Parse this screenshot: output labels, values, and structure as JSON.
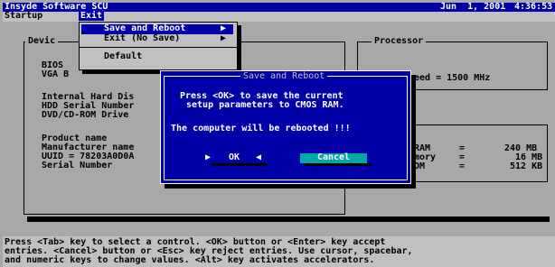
{
  "window": {
    "title": "Insyde Software SCU",
    "date": "Jun  1, 2001",
    "time": "4:36:53"
  },
  "menubar": {
    "items": [
      "Startup",
      "Exit"
    ]
  },
  "exit_menu": {
    "items": [
      {
        "label": "Save and Reboot",
        "arrow": "▶"
      },
      {
        "label": "Exit (No Save)",
        "arrow": "▶"
      },
      {
        "label": "Default",
        "arrow": ""
      }
    ]
  },
  "device_panel": {
    "title": "Devic",
    "lines": [
      "BIOS",
      "VGA B",
      "",
      "Internal Hard Dis",
      "HDD Serial Number",
      "DVD/CD-ROM Drive",
      "",
      "Product name",
      "Manufacturer name",
      "UUID = 78203A0D0A",
      "Serial Number"
    ]
  },
  "processor_panel": {
    "title": "Processor",
    "speed_text": "eed = 1500 MHz"
  },
  "memory_panel": {
    "rows": [
      {
        "label": "RAM",
        "eq": "=",
        "value": "240 MB"
      },
      {
        "label": "mory",
        "eq": "=",
        "value": "16 MB"
      },
      {
        "label": "OM",
        "eq": "=",
        "value": "512 KB"
      }
    ]
  },
  "dialog": {
    "title": "Save and Reboot",
    "message_line1": "Press <OK> to save the current",
    "message_line2": "setup parameters to CMOS RAM.",
    "message_line3": "The computer will be rebooted !!!",
    "ok_label": "OK",
    "cancel_label": "Cancel",
    "ok_left_marker": "▶",
    "ok_right_marker": "◀"
  },
  "status": {
    "line1": "Press <Tab> key to select a control. <OK> button or <Enter> key accept",
    "line2": "entries. <Cancel> button or <Esc> key reject entries. Use cursor, spacebar,",
    "line3": "and numeric keys to change values. <Alt> key activates accelerators."
  },
  "colors": {
    "background": "#a8a8a8",
    "title_bar": "#0000a8",
    "dialog": "#0000a8",
    "cancel_button": "#00a8a8",
    "menu_bg": "#c0c0c0"
  }
}
